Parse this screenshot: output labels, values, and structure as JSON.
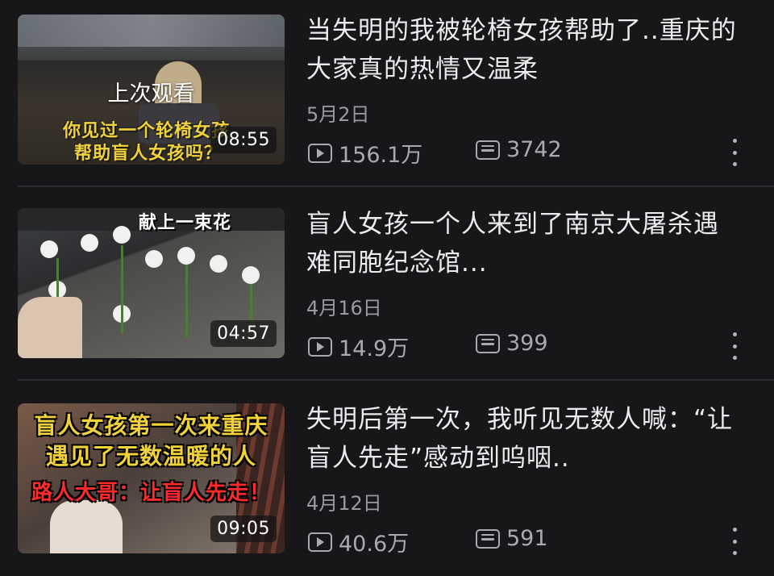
{
  "videos": [
    {
      "title": "当失明的我被轮椅女孩帮助了..重庆的大家真的热情又温柔",
      "date": "5月2日",
      "views": "156.1万",
      "comments": "3742",
      "duration": "08:55",
      "watched_label": "上次观看",
      "thumb_caption_1": "你见过一个轮椅女孩",
      "thumb_caption_2": "帮助盲人女孩吗？"
    },
    {
      "title": "盲人女孩一个人来到了南京大屠杀遇难同胞纪念馆...",
      "date": "4月16日",
      "views": "14.9万",
      "comments": "399",
      "duration": "04:57",
      "thumb_caption_1": "献上一束花"
    },
    {
      "title": "失明后第一次，我听见无数人喊：“让盲人先走”感动到呜咽..",
      "date": "4月12日",
      "views": "40.6万",
      "comments": "591",
      "duration": "09:05",
      "thumb_caption_1": "盲人女孩第一次来重庆",
      "thumb_caption_2": "遇见了无数温暖的人",
      "thumb_caption_3": "路人大哥：让盲人先走！"
    }
  ],
  "colors": {
    "background": "#17171a",
    "title": "#ececef",
    "meta": "#9a9aa1",
    "caption_yellow": "#f2d23a",
    "caption_red": "#ff2a2a"
  },
  "icons": [
    "play-count-icon",
    "comment-count-icon",
    "more-vertical-icon"
  ]
}
